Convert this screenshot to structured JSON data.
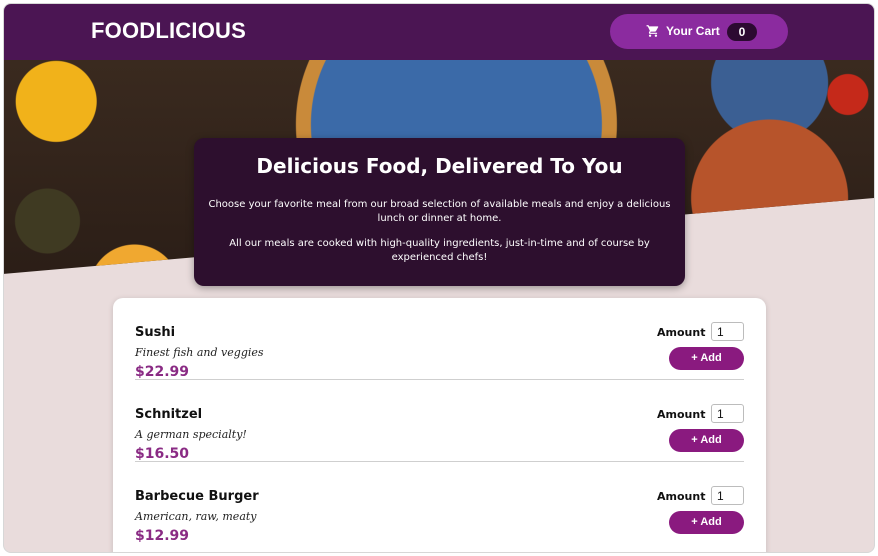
{
  "header": {
    "logo": "FOODLICIOUS",
    "cart": {
      "label": "Your Cart",
      "count": "0",
      "icon": "cart-icon"
    }
  },
  "summary": {
    "title": "Delicious Food, Delivered To You",
    "paragraph1": "Choose your favorite meal from our broad selection of available meals and enjoy a delicious lunch or dinner at home.",
    "paragraph2": "All our meals are cooked with high-quality ingredients, just-in-time and of course by experienced chefs!"
  },
  "meals": [
    {
      "name": "Sushi",
      "description": "Finest fish and veggies",
      "price": "$22.99",
      "amount_label": "Amount",
      "amount_value": "1",
      "add_label": "+ Add"
    },
    {
      "name": "Schnitzel",
      "description": "A german specialty!",
      "price": "$16.50",
      "amount_label": "Amount",
      "amount_value": "1",
      "add_label": "+ Add"
    },
    {
      "name": "Barbecue Burger",
      "description": "American, raw, meaty",
      "price": "$12.99",
      "amount_label": "Amount",
      "amount_value": "1",
      "add_label": "+ Add"
    }
  ],
  "colors": {
    "header": "#4b1553",
    "cart_button": "#8b2b9f",
    "summary_bg": "#2d0f2e",
    "price": "#8a2b84",
    "add_button": "#8a1a7f",
    "page_bg": "#e9dcdc"
  }
}
